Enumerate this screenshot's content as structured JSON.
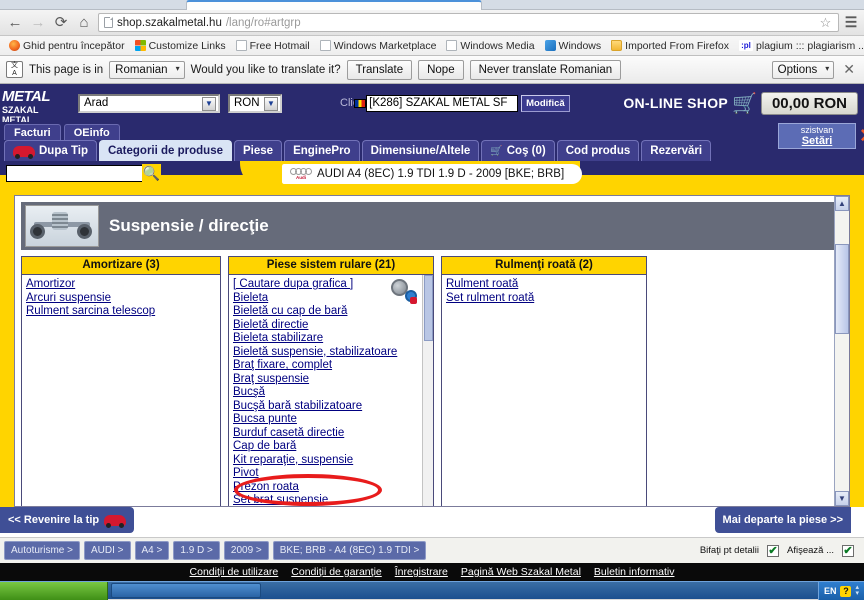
{
  "browser": {
    "nav": {
      "back": "←",
      "forward": "→",
      "reload": "⟳",
      "home": "⌂"
    },
    "url_host": "shop.szakalmetal.hu",
    "url_path": "/lang/ro#artgrp",
    "star": "☆",
    "menu": "☰",
    "bookmarks": [
      {
        "label": "Ghid pentru începător",
        "icon": "firefox-icon"
      },
      {
        "label": "Customize Links",
        "icon": "microsoft-icon"
      },
      {
        "label": "Free Hotmail",
        "icon": "document-icon"
      },
      {
        "label": "Windows Marketplace",
        "icon": "document-icon"
      },
      {
        "label": "Windows Media",
        "icon": "document-icon"
      },
      {
        "label": "Windows",
        "icon": "windows-icon"
      },
      {
        "label": "Imported From Firefox",
        "icon": "folder-icon"
      },
      {
        "label": "plagium ::: plagiarism ...",
        "icon": "plagium-icon"
      }
    ],
    "bookmarks_overflow": "»"
  },
  "translate_bar": {
    "icon_text": "文A",
    "prefix": "This page is in",
    "language": "Romanian",
    "question": "Would you like to translate it?",
    "translate_label": "Translate",
    "nope_label": "Nope",
    "never_label": "Never translate Romanian",
    "options_label": "Options",
    "close": "✕"
  },
  "site_header": {
    "logo_line1": "METAL",
    "logo_line2": "SZAKAL METAL",
    "branch": "Arad",
    "currency": "RON",
    "client_label": "Client",
    "client_value": "[K286] SZAKAL METAL SF",
    "modify_label": "Modifică",
    "shop_label": "ON-LINE SHOP",
    "cart_icon": "shopping-cart-icon",
    "cart_total": "00,00 RON"
  },
  "nav": {
    "subtabs": [
      "Facturi",
      "OEinfo"
    ],
    "maintabs": [
      {
        "label": "Dupa Tip",
        "icon": "car-icon",
        "active": false
      },
      {
        "label": "Categorii de produse",
        "icon": "",
        "active": true
      },
      {
        "label": "Piese",
        "icon": "",
        "active": false
      },
      {
        "label": "EnginePro",
        "icon": "",
        "active": false
      },
      {
        "label": "Dimensiune/Altele",
        "icon": "",
        "active": false
      },
      {
        "label": "Coş (0)",
        "icon": "cart-icon",
        "active": false
      },
      {
        "label": "Cod produs",
        "icon": "",
        "active": false
      },
      {
        "label": "Rezervări",
        "icon": "",
        "active": false
      }
    ],
    "settings_user": "szistvan",
    "settings_label": "Setări",
    "settings_close": "✕"
  },
  "search": {
    "value": "",
    "icon": "search-icon"
  },
  "vehicle": {
    "brand_icon": "audi-rings-icon",
    "label": "AUDI A4 (8EC) 1.9 TDI 1.9 D - 2009 [BKE; BRB]"
  },
  "section": {
    "title": "Suspensie / direcţie",
    "thumb": "suspension-thumbnail"
  },
  "columns": [
    {
      "title": "Amortizare (3)",
      "graphic_link": "",
      "items": [
        "Amortizor",
        "Arcuri suspensie",
        "Rulment sarcina telescop"
      ]
    },
    {
      "title": "Piese sistem rulare (21)",
      "graphic_link": "[ Cautare dupa grafica ]",
      "gear_icon": "parts-graphic-icon",
      "items": [
        "Bieleta",
        "Bieletă cu cap de bară",
        "Bieletă directie",
        "Bieleta stabilizare",
        "Bieletă suspensie, stabilizatoare",
        "Braţ fixare, complet",
        "Braţ suspensie",
        "Bucşă",
        "Bucşă bară stabilizatoare",
        "Bucsa punte",
        "Burduf casetă directie",
        "Cap de bară",
        "Kit reparaţie, suspensie",
        "Pivot",
        "Prezon roata",
        "Set brat suspensie"
      ]
    },
    {
      "title": "Rulmenţi roată (2)",
      "graphic_link": "",
      "items": [
        "Rulment roată",
        "Set rulment roată"
      ]
    }
  ],
  "footer_nav": {
    "back_label": "<< Revenire la tip",
    "back_icon": "car-icon",
    "forward_label": "Mai departe la piese >>"
  },
  "breadcrumbs": [
    "Autoturisme >",
    "AUDI >",
    "A4 >",
    "1.9 D >",
    "2009 >",
    "BKE; BRB - A4 (8EC) 1.9 TDI >"
  ],
  "breadcrumb_options": [
    {
      "label": "Bifaţi pt detalii",
      "checked": "✔"
    },
    {
      "label": "Afişează ...",
      "checked": "✔"
    }
  ],
  "site_footer_links": [
    "Condiţii de utilizare",
    "Condiţii de garanţie",
    "Înregistrare",
    "Pagină Web Szakal Metal",
    "Buletin informativ"
  ],
  "taskbar": {
    "lang": "EN",
    "help": "?",
    "updown": "⌃⌄"
  },
  "colors": {
    "site_blue": "#2a2a6e",
    "accent_yellow": "#ffd400",
    "link_blue": "#000080",
    "highlight_red": "#e81c1c"
  }
}
